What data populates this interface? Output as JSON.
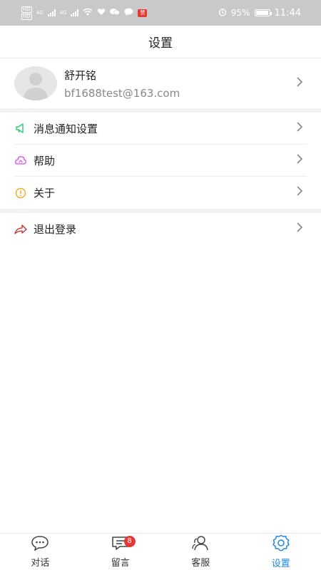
{
  "status_bar": {
    "battery": "95%",
    "time": "11:44",
    "carrier_hd_top": "HD",
    "carrier_hd_bottom": "HD",
    "network_a": "4G",
    "network_b": "4G",
    "app_badge": "赞"
  },
  "header": {
    "title": "设置"
  },
  "profile": {
    "name": "舒开铭",
    "email": "bf1688test@163.com"
  },
  "menu_group_1": [
    {
      "label": "消息通知设置",
      "icon": "megaphone-icon",
      "color": "#2ecc71"
    },
    {
      "label": "帮助",
      "icon": "help-cloud-icon",
      "color": "#e040fb"
    },
    {
      "label": "关于",
      "icon": "info-alert-icon",
      "color": "#f5a623"
    }
  ],
  "menu_group_2": [
    {
      "label": "退出登录",
      "icon": "logout-arrow-icon",
      "color": "#c62828"
    }
  ],
  "tabs": [
    {
      "label": "对话",
      "icon": "chat-bubble-icon",
      "badge": ""
    },
    {
      "label": "留言",
      "icon": "message-icon",
      "badge": "8"
    },
    {
      "label": "客服",
      "icon": "customer-service-icon",
      "badge": ""
    },
    {
      "label": "设置",
      "icon": "settings-gear-icon",
      "badge": "",
      "active": true
    }
  ],
  "colors": {
    "accent": "#1e88e5",
    "badge": "#e53935"
  }
}
